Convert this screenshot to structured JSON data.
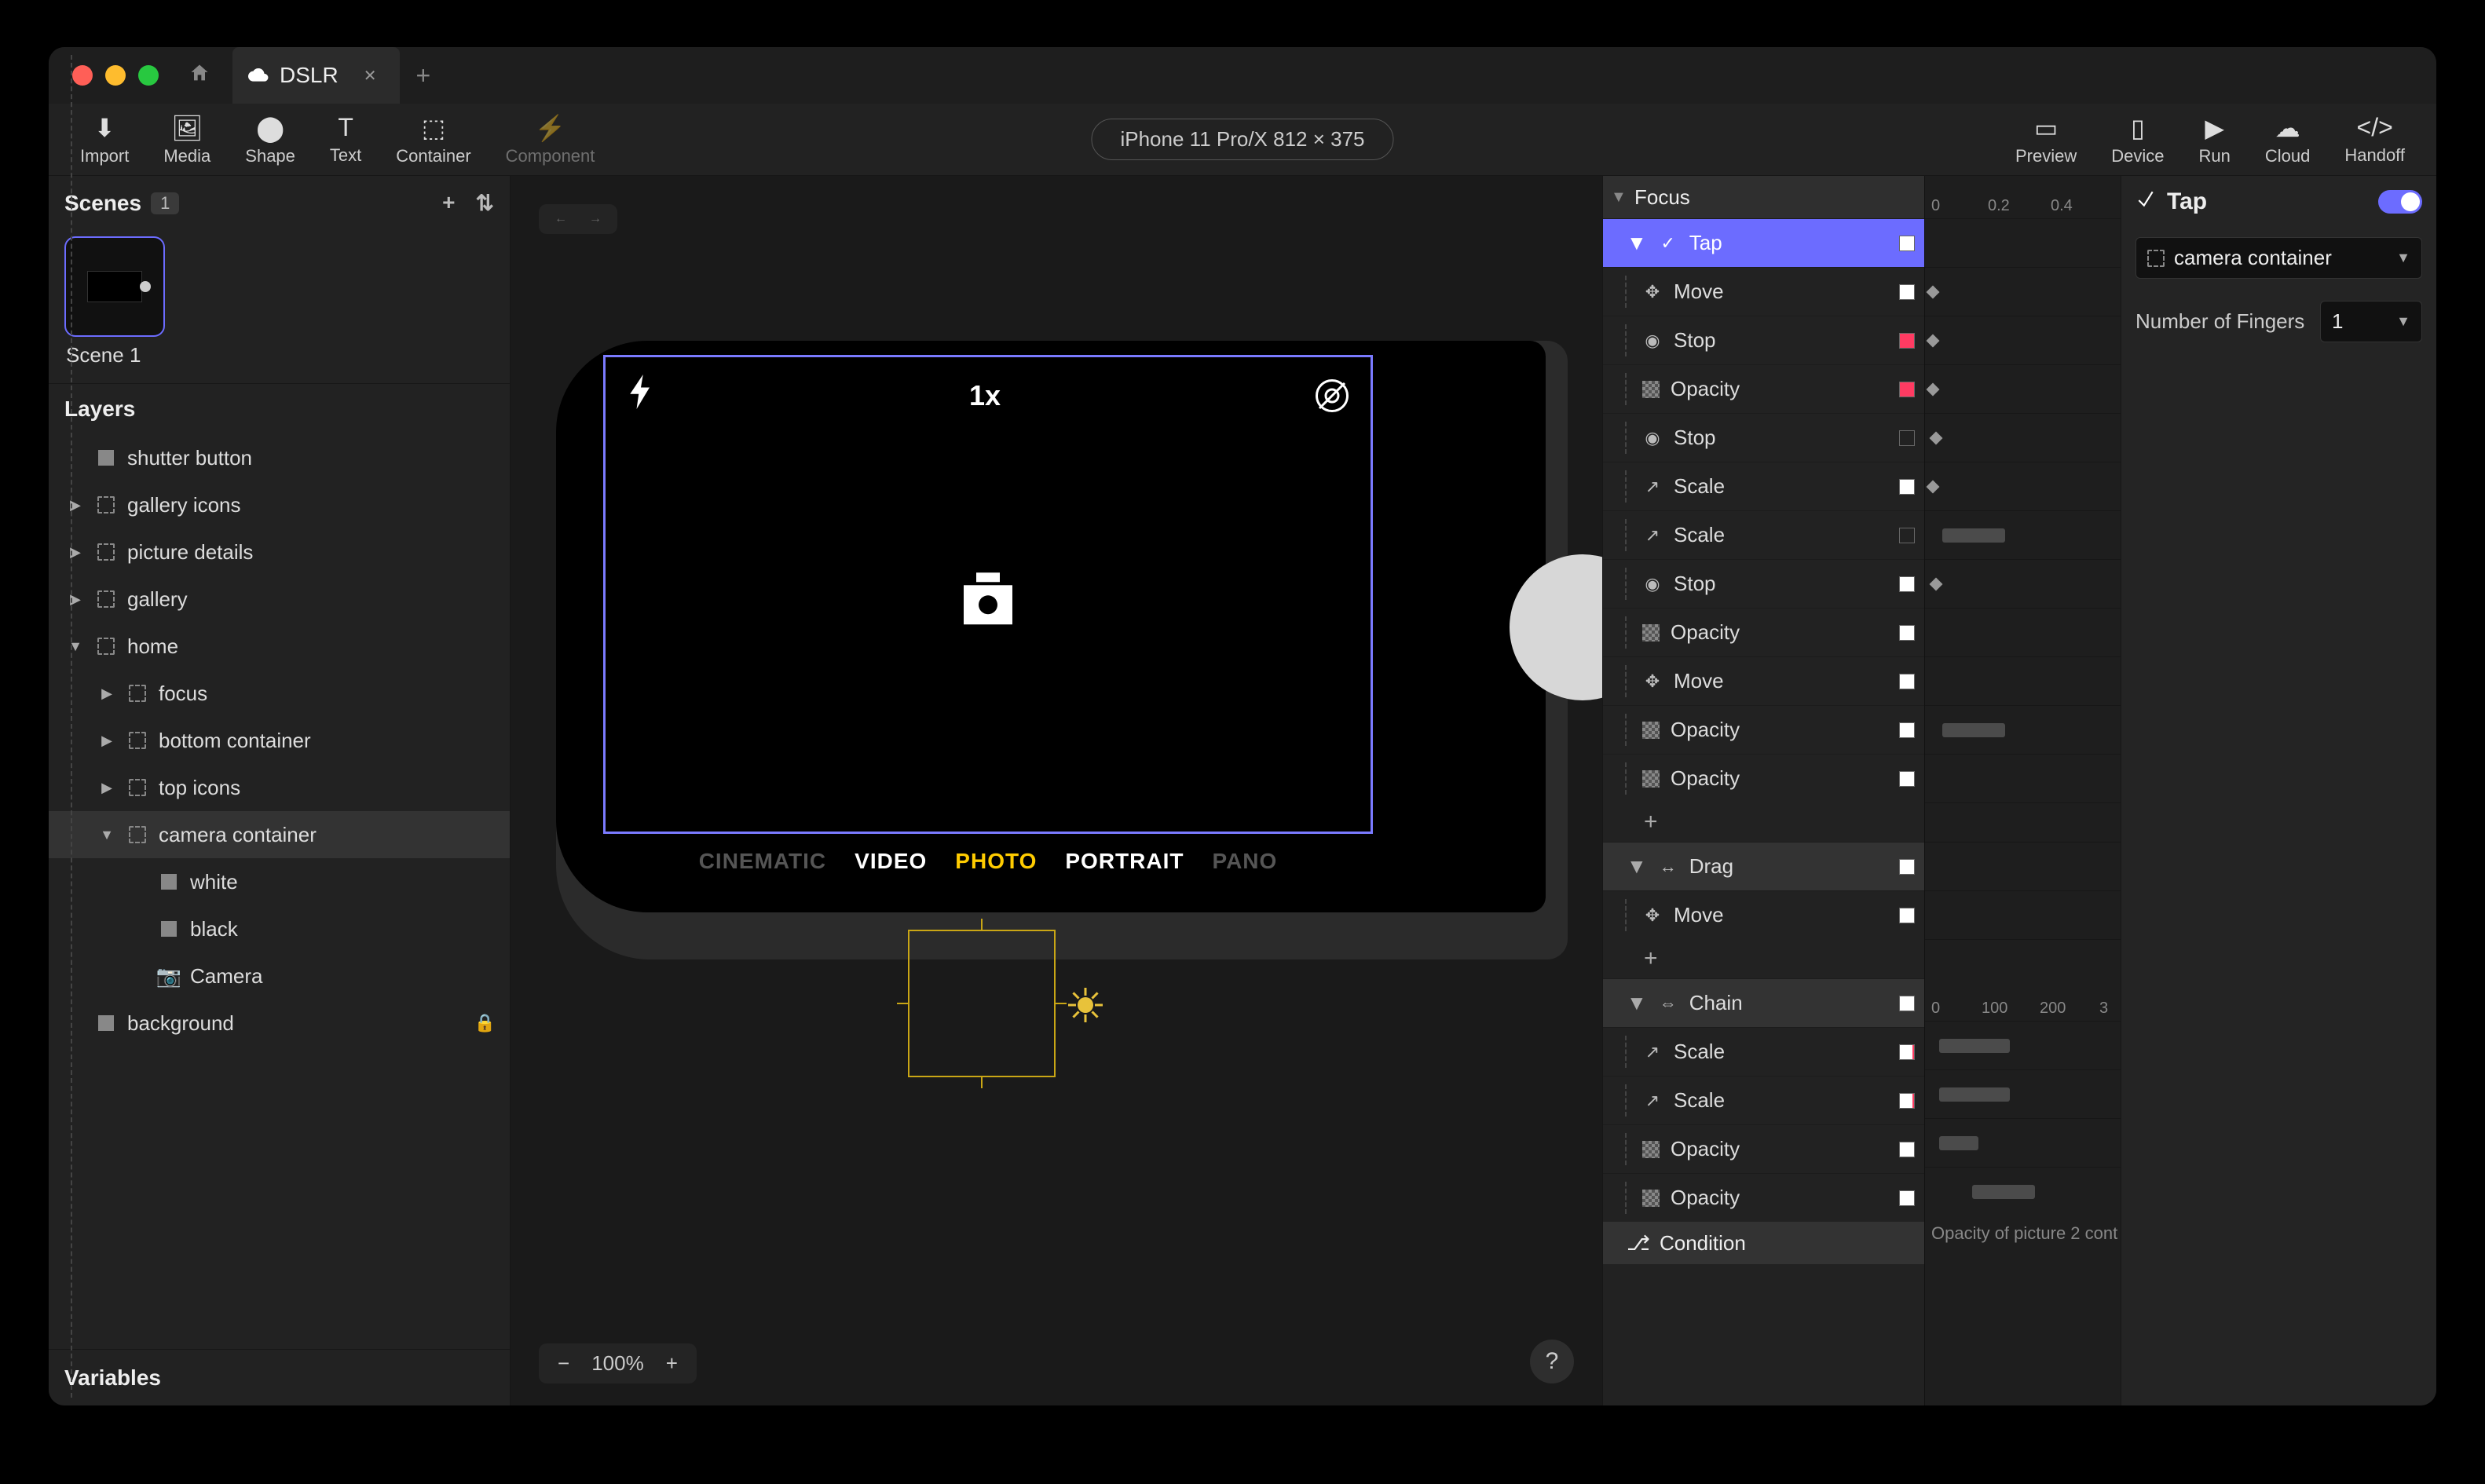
{
  "tab": {
    "title": "DSLR"
  },
  "toolbar": {
    "import": "Import",
    "media": "Media",
    "shape": "Shape",
    "text": "Text",
    "container": "Container",
    "component": "Component",
    "preview": "Preview",
    "device": "Device",
    "run": "Run",
    "cloud": "Cloud",
    "handoff": "Handoff",
    "device_label": "iPhone 11 Pro/X  812 × 375"
  },
  "scenes": {
    "title": "Scenes",
    "count": "1",
    "item": "Scene 1"
  },
  "layers": {
    "title": "Layers",
    "items": [
      {
        "indent": 0,
        "icon": "square",
        "label": "shutter button",
        "arrow": ""
      },
      {
        "indent": 0,
        "icon": "dash",
        "label": "gallery icons",
        "arrow": "▶"
      },
      {
        "indent": 0,
        "icon": "dash",
        "label": "picture details",
        "arrow": "▶"
      },
      {
        "indent": 0,
        "icon": "dash",
        "label": "gallery",
        "arrow": "▶"
      },
      {
        "indent": 0,
        "icon": "dash",
        "label": "home",
        "arrow": "▼"
      },
      {
        "indent": 1,
        "icon": "dash",
        "label": "focus",
        "arrow": "▶"
      },
      {
        "indent": 1,
        "icon": "dash",
        "label": "bottom container",
        "arrow": "▶"
      },
      {
        "indent": 1,
        "icon": "dash",
        "label": "top icons",
        "arrow": "▶"
      },
      {
        "indent": 1,
        "icon": "dash",
        "label": "camera container",
        "arrow": "▼",
        "selected": true
      },
      {
        "indent": 2,
        "icon": "square",
        "label": "white",
        "arrow": ""
      },
      {
        "indent": 2,
        "icon": "square",
        "label": "black",
        "arrow": ""
      },
      {
        "indent": 2,
        "icon": "camera",
        "label": "Camera",
        "arrow": ""
      },
      {
        "indent": 0,
        "icon": "square",
        "label": "background",
        "arrow": "",
        "locked": true
      }
    ]
  },
  "variables": {
    "title": "Variables"
  },
  "canvas": {
    "zoom": "100%",
    "vf_zoom": "1x",
    "modes": {
      "cinematic": "CINEMATIC",
      "video": "VIDEO",
      "photo": "PHOTO",
      "portrait": "PORTRAIT",
      "pano": "PANO"
    }
  },
  "anim": {
    "focus_header": "Focus",
    "groups": [
      {
        "type": "trigger",
        "label": "Tap",
        "icon": "tap",
        "selected": true,
        "swatch": "white"
      },
      {
        "type": "action",
        "label": "Move",
        "icon": "move",
        "swatch": "white"
      },
      {
        "type": "action",
        "label": "Stop",
        "icon": "stop",
        "swatch": "pink"
      },
      {
        "type": "action",
        "label": "Opacity",
        "icon": "opacity",
        "swatch": "pink"
      },
      {
        "type": "action",
        "label": "Stop",
        "icon": "stop",
        "swatch": "empty"
      },
      {
        "type": "action",
        "label": "Scale",
        "icon": "scale",
        "swatch": "white"
      },
      {
        "type": "action",
        "label": "Scale",
        "icon": "scale",
        "swatch": "empty"
      },
      {
        "type": "action",
        "label": "Stop",
        "icon": "stop",
        "swatch": "white"
      },
      {
        "type": "action",
        "label": "Opacity",
        "icon": "opacity",
        "swatch": "white"
      },
      {
        "type": "action",
        "label": "Move",
        "icon": "move",
        "swatch": "white"
      },
      {
        "type": "action",
        "label": "Opacity",
        "icon": "opacity",
        "swatch": "white"
      },
      {
        "type": "action",
        "label": "Opacity",
        "icon": "opacity",
        "swatch": "white"
      },
      {
        "type": "add"
      },
      {
        "type": "trigger",
        "label": "Drag",
        "icon": "drag",
        "swatch": "white"
      },
      {
        "type": "action",
        "label": "Move",
        "icon": "move",
        "swatch": "white"
      },
      {
        "type": "add"
      },
      {
        "type": "trigger",
        "label": "Chain",
        "icon": "chain",
        "swatch": "white"
      },
      {
        "type": "action",
        "label": "Scale",
        "icon": "scale",
        "swatch": "red"
      },
      {
        "type": "action",
        "label": "Scale",
        "icon": "scale",
        "swatch": "red"
      },
      {
        "type": "action",
        "label": "Opacity",
        "icon": "opacity",
        "swatch": "white"
      },
      {
        "type": "action",
        "label": "Opacity",
        "icon": "opacity",
        "swatch": "white"
      },
      {
        "type": "header_sub",
        "label": "Condition",
        "icon": "cond"
      }
    ],
    "timeline": {
      "ruler1": [
        "0",
        "0.2",
        "0.4"
      ],
      "ruler2": [
        "0",
        "100",
        "200",
        "3"
      ],
      "footer": "Opacity of picture 2 cont"
    }
  },
  "props": {
    "trigger_title": "Tap",
    "target": "camera container",
    "fingers_label": "Number of Fingers",
    "fingers_value": "1"
  }
}
